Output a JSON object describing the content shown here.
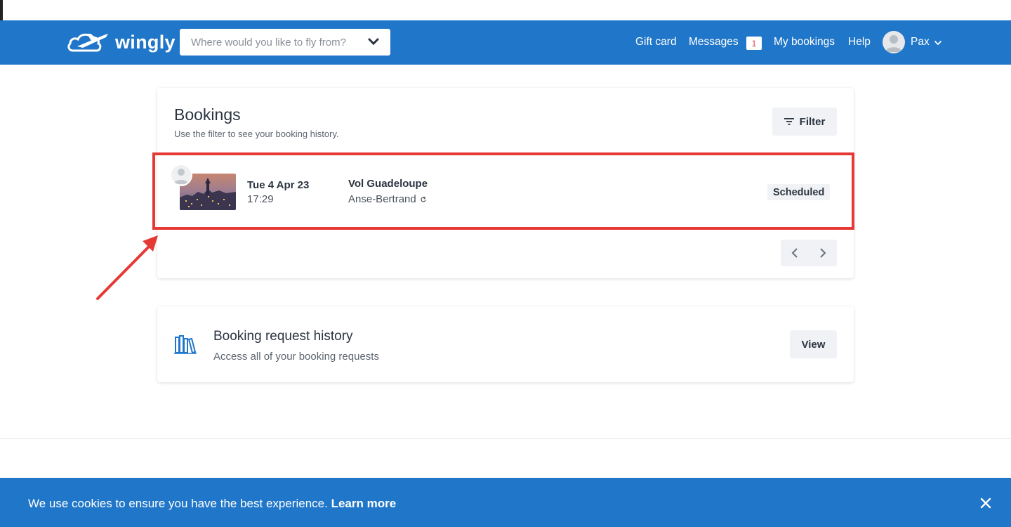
{
  "brand": {
    "name": "wingly",
    "color": "#2076c8"
  },
  "search": {
    "placeholder": "Where would you like to fly from?",
    "icon": "chevron-down-icon"
  },
  "nav": {
    "gift_card": "Gift card",
    "messages": "Messages",
    "messages_badge": "1",
    "my_bookings": "My bookings",
    "help": "Help",
    "user_name": "Pax"
  },
  "bookings": {
    "title": "Bookings",
    "subtitle": "Use the filter to see your booking history.",
    "filter_label": "Filter",
    "items": [
      {
        "date": "Tue 4 Apr 23",
        "time": "17:29",
        "flight_title": "Vol Guadeloupe",
        "place": "Anse-Bertrand",
        "status": "Scheduled"
      }
    ]
  },
  "history": {
    "title": "Booking request history",
    "subtitle": "Access all of your booking requests",
    "view_label": "View"
  },
  "cookie": {
    "text": "We use cookies to ensure you have the best experience.",
    "link": "Learn more"
  },
  "colors": {
    "highlight": "#e53935",
    "badge_text": "#e03b3b"
  }
}
